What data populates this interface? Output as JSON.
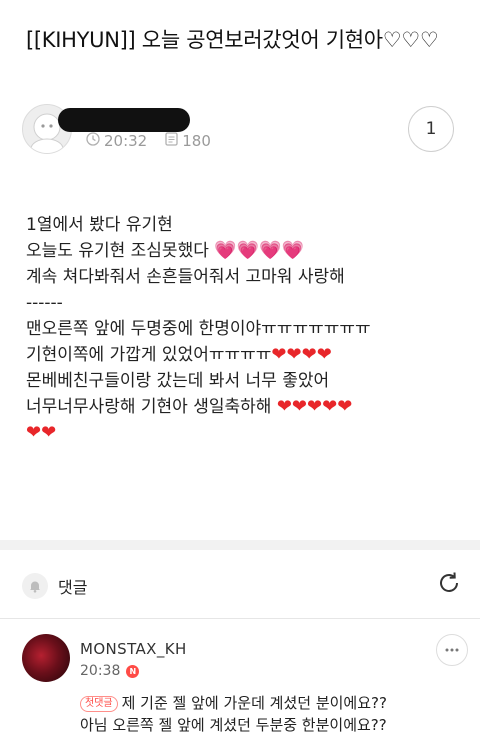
{
  "post": {
    "title": "[[KIHYUN]] 오늘 공연보러갔엇어 기현아♡♡♡",
    "time": "20:32",
    "views": "180",
    "comment_count": "1",
    "body": {
      "line1": "1열에서 봤다 유기현",
      "line2": "오늘도 유기현 조심못했다",
      "line3": "계속 쳐다봐줘서 손흔들어줘서 고마워 사랑해",
      "line4": "------",
      "line5": "맨오른쪽 앞에 두명중에 한명이야ㅠㅠㅠㅠㅠㅠㅠ",
      "line6": "기현이쪽에 가깝게 있었어ㅠㅠㅠㅠ",
      "line7": "몬베베친구들이랑 갔는데 봐서 너무 좋았어",
      "line8": "너무너무사랑해 기현아 생일축하해"
    },
    "emoji": {
      "pink_heart": "💗",
      "red_heart": "❤"
    }
  },
  "comments": {
    "label": "댓글",
    "items": [
      {
        "author": "MONSTAX_KH",
        "time": "20:38",
        "new_badge": "N",
        "first_badge": "첫댓글",
        "text_line1": "제 기준 젤 앞에 가운데 계셨던 분이에요??",
        "text_line2": "아님 오른쪽 젤 앞에 계셨던 두분중 한분이에요??"
      }
    ]
  },
  "icons": {
    "clock": "clock-icon",
    "views": "document-icon",
    "bell": "bell-icon",
    "refresh": "refresh-icon",
    "more": "more-icon"
  }
}
